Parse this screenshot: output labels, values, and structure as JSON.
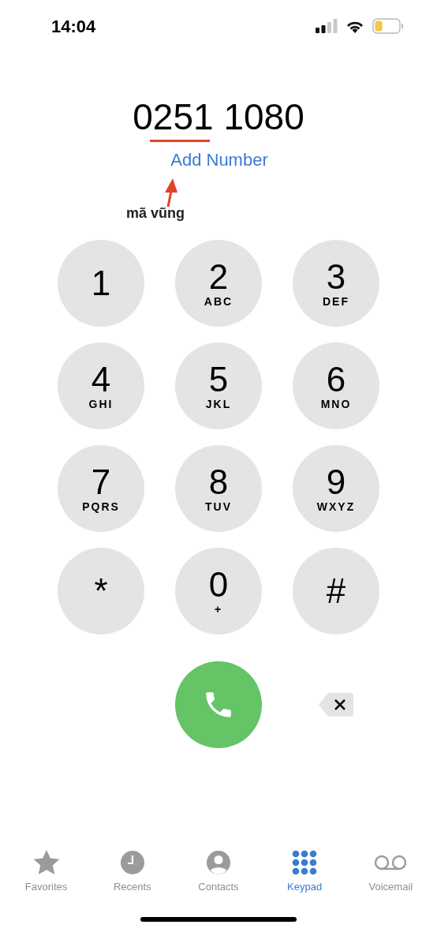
{
  "status_bar": {
    "time": "14:04"
  },
  "number": "0251 1080",
  "add_number": "Add Number",
  "annotation": {
    "label": "mã vũng"
  },
  "keys": [
    {
      "digit": "1"
    },
    {
      "digit": "2",
      "letters": "ABC"
    },
    {
      "digit": "3",
      "letters": "DEF"
    },
    {
      "digit": "4",
      "letters": "GHI"
    },
    {
      "digit": "5",
      "letters": "JKL"
    },
    {
      "digit": "6",
      "letters": "MNO"
    },
    {
      "digit": "7",
      "letters": "PQRS"
    },
    {
      "digit": "8",
      "letters": "TUV"
    },
    {
      "digit": "9",
      "letters": "WXYZ"
    },
    {
      "digit": "*"
    },
    {
      "digit": "0",
      "letters": "+"
    },
    {
      "digit": "#"
    }
  ],
  "tabs": [
    {
      "kind": "favorites",
      "label": "Favorites",
      "selected": false
    },
    {
      "kind": "recents",
      "label": "Recents",
      "selected": false
    },
    {
      "kind": "contacts",
      "label": "Contacts",
      "selected": false
    },
    {
      "kind": "keypad",
      "label": "Keypad",
      "selected": true
    },
    {
      "kind": "voicemail",
      "label": "Voicemail",
      "selected": false
    }
  ]
}
